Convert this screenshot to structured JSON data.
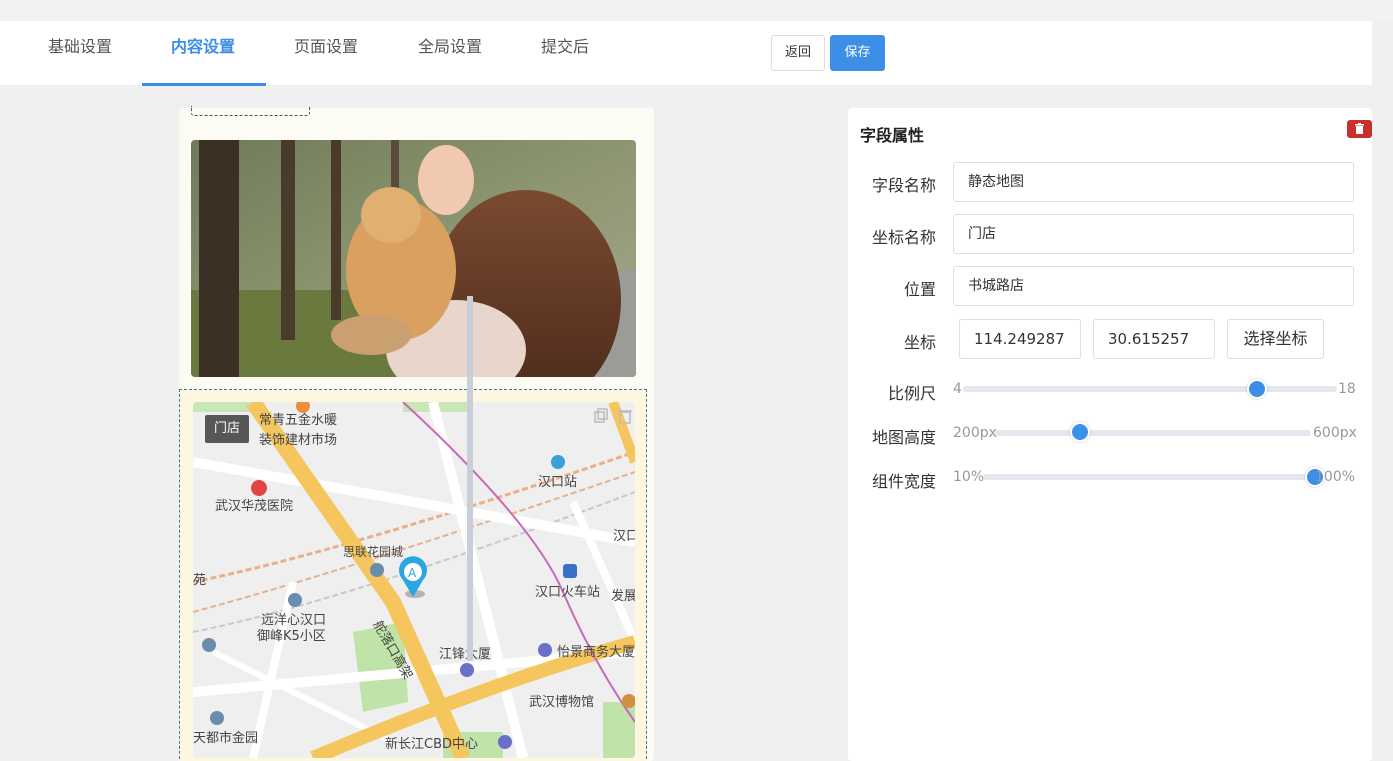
{
  "tabs": [
    {
      "label": "基础设置"
    },
    {
      "label": "内容设置"
    },
    {
      "label": "页面设置"
    },
    {
      "label": "全局设置"
    },
    {
      "label": "提交后"
    }
  ],
  "active_tab": "内容设置",
  "toolbar": {
    "back_label": "返回",
    "save_label": "保存"
  },
  "map_widget": {
    "marker_label": "门店",
    "places": {
      "p1": "常青五金水暖",
      "p2": "装饰建材市场",
      "p3": "汉口站",
      "p4": "武汉华茂医院",
      "p5": "汉口",
      "p6": "思联花园城",
      "p7": "苑",
      "p8": "汉口火车站",
      "p9": "发展",
      "p10": "远洋心汉口",
      "p11": "御峰K5小区",
      "p12": "江锋大厦",
      "p13": "怡景商务大厦",
      "p14": "武汉博物馆",
      "p15": "天都市金园",
      "p16": "新长江CBD中心",
      "p17": "舵落口高架"
    }
  },
  "panel": {
    "title": "字段属性",
    "fields": {
      "name_label": "字段名称",
      "name_value": "静态地图",
      "coord_name_label": "坐标名称",
      "coord_name_value": "门店",
      "location_label": "位置",
      "location_value": "书城路店",
      "coord_label": "坐标",
      "lng_value": "114.249287",
      "lat_value": "30.615257",
      "pick_label": "选择坐标"
    },
    "sliders": {
      "scale": {
        "label": "比例尺",
        "min": "4",
        "max": "18",
        "value": 15
      },
      "height": {
        "label": "地图高度",
        "min": "200px",
        "max": "600px",
        "value_fraction": 0.27
      },
      "width": {
        "label": "组件宽度",
        "min": "10%",
        "max": "100%",
        "value_fraction": 1.0
      }
    }
  },
  "colors": {
    "accent": "#3c8ee6",
    "danger": "#c9302c"
  },
  "icons": {
    "delete": "trash-icon",
    "copy": "copy-icon",
    "marker": "map-pin-icon"
  }
}
